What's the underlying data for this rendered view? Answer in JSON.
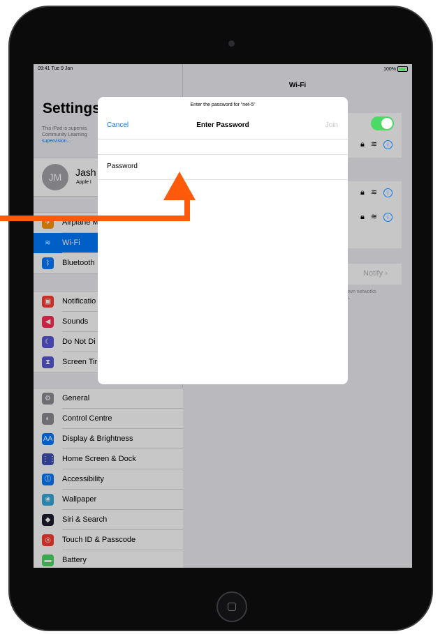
{
  "status_bar": {
    "time": "09:41  Tue 9 Jan",
    "battery": "100%"
  },
  "sidebar": {
    "title": "Settings",
    "supervision_text": "This iPad is supervis",
    "supervision_text2": "Community Learning",
    "supervision_link": "supervision...",
    "profile": {
      "initials": "JM",
      "name": "Jash",
      "subtitle": "Apple I"
    },
    "group1": [
      {
        "label": "Airplane M",
        "icon": "airplane-icon",
        "color": "#ff9500",
        "glyph": "✈"
      },
      {
        "label": "Wi-Fi",
        "icon": "wifi-icon",
        "color": "#007aff",
        "glyph": "≋",
        "selected": true
      },
      {
        "label": "Bluetooth",
        "icon": "bluetooth-icon",
        "color": "#007aff",
        "glyph": "ᛒ"
      }
    ],
    "group2": [
      {
        "label": "Notificatio",
        "icon": "notifications-icon",
        "color": "#ff3b30",
        "glyph": "▣"
      },
      {
        "label": "Sounds",
        "icon": "sounds-icon",
        "color": "#ff2d55",
        "glyph": "◀"
      },
      {
        "label": "Do Not Di",
        "icon": "moon-icon",
        "color": "#5856d6",
        "glyph": "☾"
      },
      {
        "label": "Screen Tir",
        "icon": "hourglass-icon",
        "color": "#5856d6",
        "glyph": "⧗"
      }
    ],
    "group3": [
      {
        "label": "General",
        "icon": "gear-icon",
        "color": "#8e8e93",
        "glyph": "⚙"
      },
      {
        "label": "Control Centre",
        "icon": "switches-icon",
        "color": "#8e8e93",
        "glyph": "◐"
      },
      {
        "label": "Display & Brightness",
        "icon": "display-icon",
        "color": "#007aff",
        "glyph": "AA"
      },
      {
        "label": "Home Screen & Dock",
        "icon": "grid-icon",
        "color": "#3f51b5",
        "glyph": "⋮⋮"
      },
      {
        "label": "Accessibility",
        "icon": "accessibility-icon",
        "color": "#007aff",
        "glyph": "⓵"
      },
      {
        "label": "Wallpaper",
        "icon": "flower-icon",
        "color": "#35aadc",
        "glyph": "❀"
      },
      {
        "label": "Siri & Search",
        "icon": "siri-icon",
        "color": "#1c1c2e",
        "glyph": "◆"
      },
      {
        "label": "Touch ID & Passcode",
        "icon": "fingerprint-icon",
        "color": "#ff3b30",
        "glyph": "◎"
      },
      {
        "label": "Battery",
        "icon": "battery-icon",
        "color": "#4cd964",
        "glyph": "▬"
      }
    ]
  },
  "detail": {
    "title": "Wi-Fi",
    "notify_label": "Notify",
    "own_networks_text": "own networks",
    "own_networks_text2": "s."
  },
  "modal": {
    "prompt": "Enter the password for “net-5”",
    "cancel": "Cancel",
    "title": "Enter Password",
    "join": "Join",
    "password_label": "Password",
    "password_value": "",
    "password_placeholder": ""
  },
  "colors": {
    "accent": "#007aff",
    "toggle_on": "#4cd964",
    "annotation_arrow": "#ff5a0a"
  }
}
